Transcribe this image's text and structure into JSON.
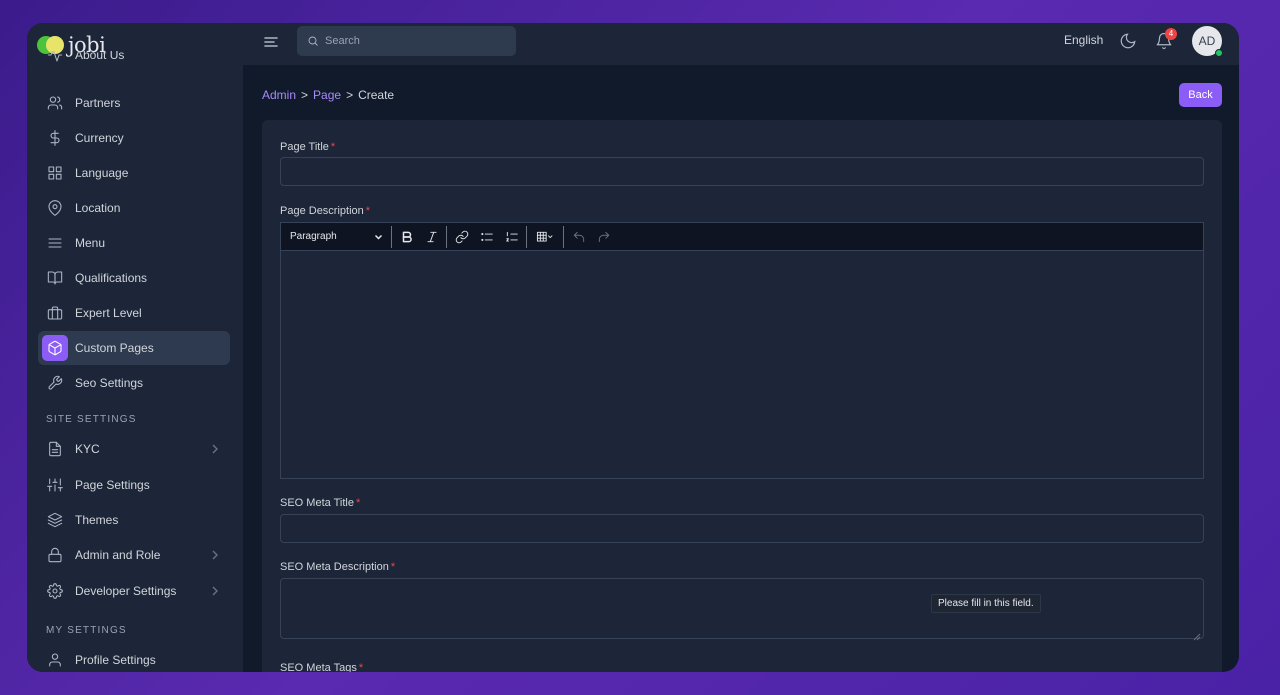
{
  "brand": {
    "name": "jobi"
  },
  "sidebar": {
    "items": [
      {
        "label": "About Us",
        "icon": "activity-icon"
      },
      {
        "label": "Partners",
        "icon": "users-icon"
      },
      {
        "label": "Currency",
        "icon": "dollar-icon"
      },
      {
        "label": "Language",
        "icon": "grid-icon"
      },
      {
        "label": "Location",
        "icon": "map-pin-icon"
      },
      {
        "label": "Menu",
        "icon": "menu-icon"
      },
      {
        "label": "Qualifications",
        "icon": "book-icon"
      },
      {
        "label": "Expert Level",
        "icon": "briefcase-icon"
      },
      {
        "label": "Custom Pages",
        "icon": "box-icon",
        "active": true
      },
      {
        "label": "Seo Settings",
        "icon": "wrench-icon"
      }
    ],
    "site_settings_title": "SITE SETTINGS",
    "site_settings": [
      {
        "label": "KYC",
        "icon": "file-icon",
        "has_children": true
      },
      {
        "label": "Page Settings",
        "icon": "sliders-icon"
      },
      {
        "label": "Themes",
        "icon": "layers-icon"
      },
      {
        "label": "Admin and Role",
        "icon": "lock-icon",
        "has_children": true
      },
      {
        "label": "Developer Settings",
        "icon": "gear-icon",
        "has_children": true
      }
    ],
    "my_settings_title": "MY SETTINGS",
    "my_settings": [
      {
        "label": "Profile Settings",
        "icon": "user-icon"
      }
    ]
  },
  "header": {
    "search_placeholder": "Search",
    "language": "English",
    "notification_count": "4",
    "avatar_initials": "AD"
  },
  "breadcrumb": {
    "admin": "Admin",
    "page": "Page",
    "current": "Create",
    "separator": ">"
  },
  "back_label": "Back",
  "form": {
    "page_title_label": "Page Title",
    "page_description_label": "Page Description",
    "paragraph_option": "Paragraph",
    "seo_meta_title_label": "SEO Meta Title",
    "seo_meta_description_label": "SEO Meta Description",
    "seo_meta_tags_label": "SEO Meta Tags",
    "required_mark": "*",
    "validation_tooltip": "Please fill in this field."
  },
  "colors": {
    "accent": "#8b5cf6",
    "background": "#111a2b",
    "panel": "#1c2638",
    "required": "#ef4444"
  }
}
